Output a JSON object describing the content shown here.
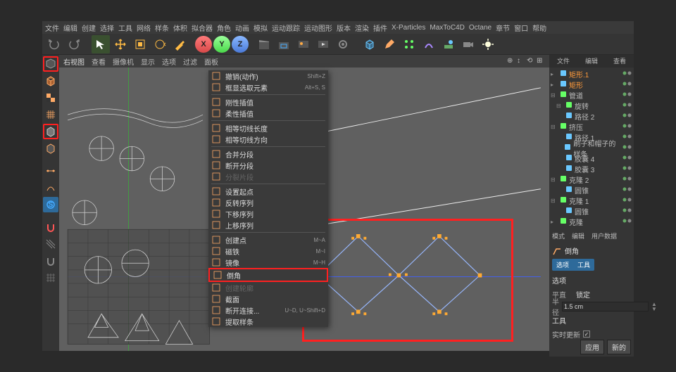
{
  "menu": [
    "文件",
    "编辑",
    "创建",
    "选择",
    "工具",
    "网络",
    "样条",
    "体积",
    "拟合器",
    "角色",
    "动画",
    "模拟",
    "运动跟踪",
    "运动图形",
    "版本",
    "渲染",
    "插件",
    "X-Particles",
    "MaxToC4D",
    "Octane",
    "章节",
    "窗口",
    "帮助"
  ],
  "viewport_header": {
    "view_name": "右视图",
    "tabs": [
      "查看",
      "摄像机",
      "显示",
      "选项",
      "过滤",
      "面板"
    ]
  },
  "left_icons": [
    {
      "name": "make-editable",
      "hl": true
    },
    {
      "name": "cube"
    },
    {
      "name": "fract"
    },
    {
      "name": "floor"
    },
    {
      "name": "object",
      "hl": true
    },
    {
      "name": "object2"
    },
    {
      "name": "divider"
    },
    {
      "name": "tline"
    },
    {
      "name": "uline"
    },
    {
      "name": "selcircle"
    },
    {
      "name": "divider"
    },
    {
      "name": "magnet"
    },
    {
      "name": "hatch"
    },
    {
      "name": "magnet2"
    },
    {
      "name": "rect"
    }
  ],
  "ctx": [
    {
      "t": "撤销(动作)",
      "sc": "Shift+Z",
      "i": "undo"
    },
    {
      "t": "框显选取元素",
      "sc": "Alt+S, S",
      "i": "frame"
    },
    {
      "sep": true
    },
    {
      "t": "刚性插值",
      "i": "interp"
    },
    {
      "t": "柔性插值",
      "i": "interp2"
    },
    {
      "sep": true
    },
    {
      "t": "相等切线长度",
      "i": "tan"
    },
    {
      "t": "相等切线方向",
      "i": "tan2"
    },
    {
      "sep": true
    },
    {
      "t": "合并分段",
      "i": "merge"
    },
    {
      "t": "断开分段",
      "i": "split"
    },
    {
      "t": "分裂片段",
      "dim": true,
      "i": "spl"
    },
    {
      "sep": true
    },
    {
      "t": "设置起点",
      "i": "213"
    },
    {
      "t": "反转序列",
      "i": "123"
    },
    {
      "t": "下移序列",
      "i": "213b"
    },
    {
      "t": "上移序列",
      "i": "231"
    },
    {
      "sep": true
    },
    {
      "t": "创建点",
      "sc": "M~A",
      "i": "pt"
    },
    {
      "t": "磁铁",
      "sc": "M~I",
      "i": "mag"
    },
    {
      "t": "镜像",
      "sc": "M~H",
      "i": "mir"
    },
    {
      "t": "倒角",
      "hl": true,
      "i": "bev"
    },
    {
      "t": "创建轮廓",
      "dim": true,
      "i": "out"
    },
    {
      "t": "截面",
      "i": "sec"
    },
    {
      "t": "断开连接...",
      "sc": "U~D, U~Shift+D",
      "i": "disc"
    },
    {
      "t": "提取样条",
      "i": "ext"
    }
  ],
  "right_tabs": [
    "文件",
    "编辑",
    "查看"
  ],
  "tree": [
    {
      "l": "矩形.1",
      "c": "orange",
      "ind": 0,
      "chev": "▸",
      "ico": "spline"
    },
    {
      "l": "矩形",
      "c": "orange",
      "ind": 0,
      "chev": "▸",
      "ico": "spline"
    },
    {
      "l": "管道",
      "c": "",
      "ind": 0,
      "chev": "⊟",
      "ico": "gen"
    },
    {
      "l": "旋转",
      "c": "",
      "ind": 1,
      "chev": "⊟",
      "ico": "gen"
    },
    {
      "l": "路径 2",
      "c": "",
      "ind": 1,
      "chev": " ",
      "ico": "spline"
    },
    {
      "l": "挤压",
      "c": "",
      "ind": 0,
      "chev": "⊟",
      "ico": "gen"
    },
    {
      "l": "路径 1",
      "c": "",
      "ind": 1,
      "chev": " ",
      "ico": "spline"
    },
    {
      "l": "刷子和帽子的样条",
      "c": "",
      "ind": 1,
      "chev": " ",
      "ico": "spline"
    },
    {
      "l": "胶囊 4",
      "c": "",
      "ind": 1,
      "chev": " ",
      "ico": "prim"
    },
    {
      "l": "胶囊 3",
      "c": "",
      "ind": 1,
      "chev": " ",
      "ico": "prim"
    },
    {
      "l": "克隆 2",
      "c": "",
      "ind": 0,
      "chev": "⊟",
      "ico": "clone"
    },
    {
      "l": "圆锥",
      "c": "",
      "ind": 1,
      "chev": " ",
      "ico": "prim"
    },
    {
      "l": "克隆 1",
      "c": "",
      "ind": 0,
      "chev": "⊟",
      "ico": "clone"
    },
    {
      "l": "圆锥",
      "c": "",
      "ind": 1,
      "chev": " ",
      "ico": "prim"
    },
    {
      "l": "克隆",
      "c": "",
      "ind": 0,
      "chev": "▸",
      "ico": "clone"
    }
  ],
  "attr_tabs": [
    "模式",
    "编辑",
    "用户数据"
  ],
  "attr": {
    "title": "倒角",
    "subtabs": [
      "选项",
      "工具"
    ],
    "section1": "选项",
    "row_flat_label": "平直",
    "row_flat_value": "锁定",
    "row_radius_label": "半径",
    "row_radius_value": "1.5 cm",
    "section2": "工具",
    "rt_label": "实时更新",
    "rt_checked": true,
    "apply_label": "应用",
    "new_label": "新的"
  },
  "toolbar_icons": [
    "undo",
    "redo",
    "sep",
    "live-select",
    "move",
    "scale",
    "rotate",
    "lastcmd",
    "sep",
    "x",
    "y",
    "z",
    "sep",
    "render",
    "render-region",
    "picture-viewer",
    "anim1",
    "anim2",
    "sep",
    "cube",
    "pen",
    "array",
    "deform",
    "scene",
    "camera",
    "light",
    "tag",
    "spotlight"
  ]
}
